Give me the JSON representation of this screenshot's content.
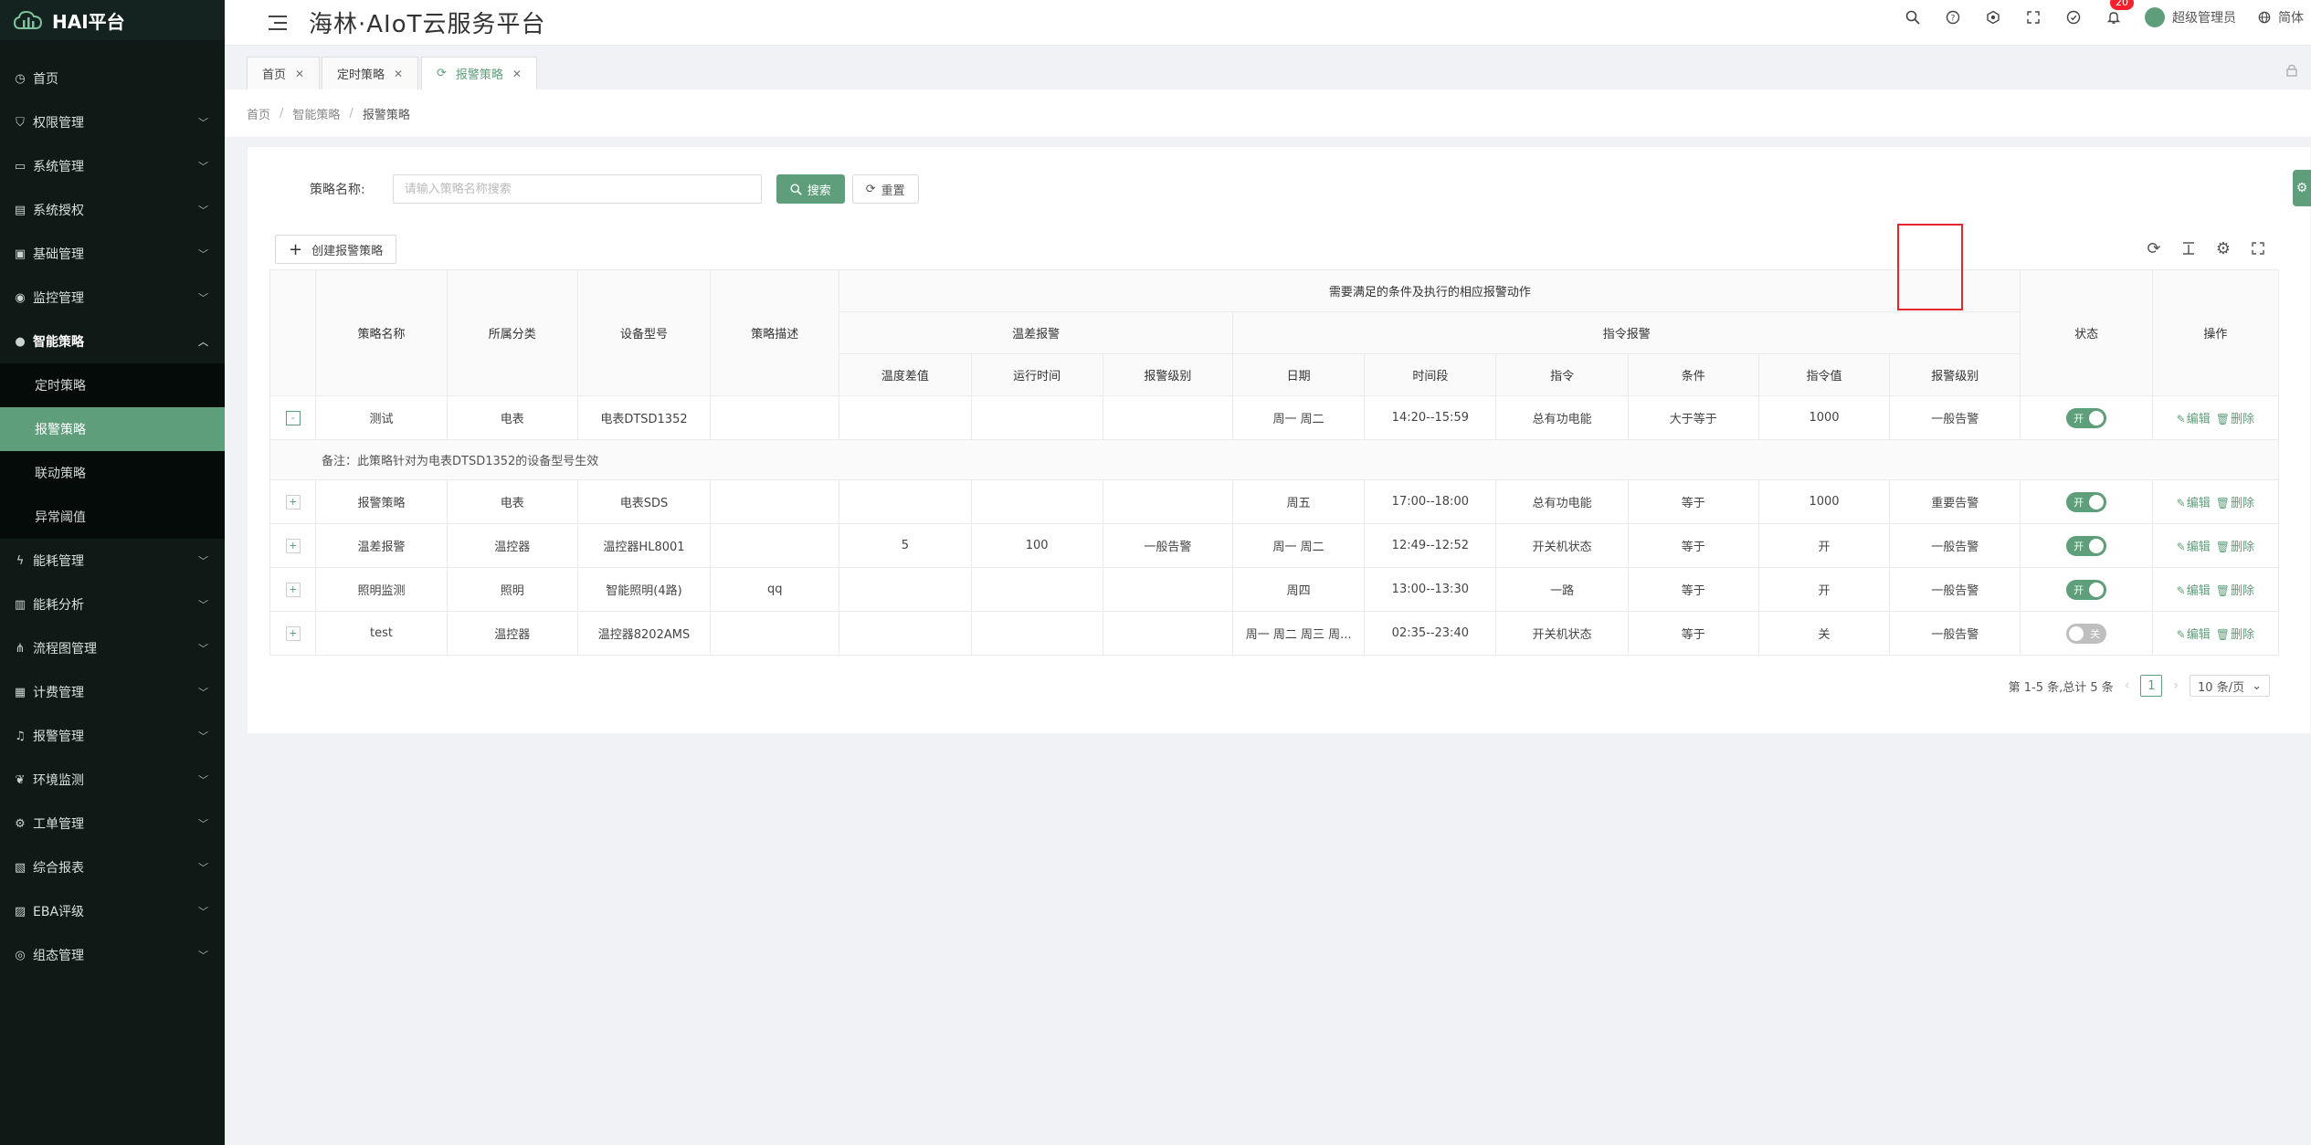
{
  "app": {
    "logo_text": "HAI平台",
    "platform_title": "海林·AIoT云服务平台"
  },
  "sidebar": {
    "items": [
      {
        "label": "首页",
        "icon": "clock-icon",
        "has_children": false
      },
      {
        "label": "权限管理",
        "icon": "shield-icon",
        "has_children": true
      },
      {
        "label": "系统管理",
        "icon": "monitor-icon",
        "has_children": true
      },
      {
        "label": "系统授权",
        "icon": "license-icon",
        "has_children": true
      },
      {
        "label": "基础管理",
        "icon": "box-icon",
        "has_children": true
      },
      {
        "label": "监控管理",
        "icon": "camera-icon",
        "has_children": true
      },
      {
        "label": "智能策略",
        "icon": "bulb-icon",
        "has_children": true,
        "open": true,
        "children": [
          {
            "label": "定时策略",
            "active": false
          },
          {
            "label": "报警策略",
            "active": true
          },
          {
            "label": "联动策略",
            "active": false
          },
          {
            "label": "异常阈值",
            "active": false
          }
        ]
      },
      {
        "label": "能耗管理",
        "icon": "bolt-icon",
        "has_children": true
      },
      {
        "label": "能耗分析",
        "icon": "chart-icon",
        "has_children": true
      },
      {
        "label": "流程图管理",
        "icon": "flow-icon",
        "has_children": true
      },
      {
        "label": "计费管理",
        "icon": "calendar-icon",
        "has_children": true
      },
      {
        "label": "报警管理",
        "icon": "alarm-icon",
        "has_children": true
      },
      {
        "label": "环境监测",
        "icon": "leaf-icon",
        "has_children": true
      },
      {
        "label": "工单管理",
        "icon": "gear-icon",
        "has_children": true
      },
      {
        "label": "综合报表",
        "icon": "report-icon",
        "has_children": true
      },
      {
        "label": "EBA评级",
        "icon": "grade-icon",
        "has_children": true
      },
      {
        "label": "组态管理",
        "icon": "target-icon",
        "has_children": true
      }
    ]
  },
  "header": {
    "notification_count": "20",
    "user_name": "超级管理员",
    "language": "简体"
  },
  "tabs": [
    {
      "label": "首页",
      "active": false
    },
    {
      "label": "定时策略",
      "active": false
    },
    {
      "label": "报警策略",
      "active": true
    }
  ],
  "breadcrumb": {
    "items": [
      "首页",
      "智能策略",
      "报警策略"
    ]
  },
  "search": {
    "label": "策略名称:",
    "placeholder": "请输入策略名称搜索",
    "value": "",
    "search_button": "搜索",
    "reset_button": "重置"
  },
  "toolbar": {
    "create_button": "创建报警策略"
  },
  "table": {
    "headers": {
      "name": "策略名称",
      "category": "所属分类",
      "device_model": "设备型号",
      "description": "策略描述",
      "group_conditions": "需要满足的条件及执行的相应报警动作",
      "group_temp": "温差报警",
      "group_cmd": "指令报警",
      "temp_diff": "温度差值",
      "run_time": "运行时间",
      "temp_level": "报警级别",
      "date": "日期",
      "time_range": "时间段",
      "command": "指令",
      "condition": "条件",
      "command_value": "指令值",
      "cmd_level": "报警级别",
      "status": "状态",
      "actions": "操作"
    },
    "rows": [
      {
        "name": "测试",
        "category": "电表",
        "device_model": "电表DTSD1352",
        "description": "",
        "temp_diff": "",
        "run_time": "",
        "temp_level": "",
        "date": "周一 周二",
        "time_range": "14:20--15:59",
        "command": "总有功电能",
        "condition": "大于等于",
        "command_value": "1000",
        "cmd_level": "一般告警",
        "status_label": "开",
        "enabled": true,
        "expanded": true,
        "expand_symbol": "-",
        "note": "备注：此策略针对为电表DTSD1352的设备型号生效"
      },
      {
        "name": "报警策略",
        "category": "电表",
        "device_model": "电表SDS",
        "description": "",
        "temp_diff": "",
        "run_time": "",
        "temp_level": "",
        "date": "周五",
        "time_range": "17:00--18:00",
        "command": "总有功电能",
        "condition": "等于",
        "command_value": "1000",
        "cmd_level": "重要告警",
        "status_label": "开",
        "enabled": true,
        "expanded": false,
        "expand_symbol": "+"
      },
      {
        "name": "温差报警",
        "category": "温控器",
        "device_model": "温控器HL8001",
        "description": "",
        "temp_diff": "5",
        "run_time": "100",
        "temp_level": "一般告警",
        "date": "周一 周二",
        "time_range": "12:49--12:52",
        "command": "开关机状态",
        "condition": "等于",
        "command_value": "开",
        "cmd_level": "一般告警",
        "status_label": "开",
        "enabled": true,
        "expanded": false,
        "expand_symbol": "+"
      },
      {
        "name": "照明监测",
        "category": "照明",
        "device_model": "智能照明(4路)",
        "description": "qq",
        "temp_diff": "",
        "run_time": "",
        "temp_level": "",
        "date": "周四",
        "time_range": "13:00--13:30",
        "command": "一路",
        "condition": "等于",
        "command_value": "开",
        "cmd_level": "一般告警",
        "status_label": "开",
        "enabled": true,
        "expanded": false,
        "expand_symbol": "+"
      },
      {
        "name": "test",
        "category": "温控器",
        "device_model": "温控器8202AMS",
        "description": "",
        "temp_diff": "",
        "run_time": "",
        "temp_level": "",
        "date": "周一 周二 周三 周...",
        "time_range": "02:35--23:40",
        "command": "开关机状态",
        "condition": "等于",
        "command_value": "关",
        "cmd_level": "一般告警",
        "status_label": "关",
        "enabled": false,
        "expanded": false,
        "expand_symbol": "+"
      }
    ],
    "edit_label": "编辑",
    "delete_label": "删除"
  },
  "pagination": {
    "summary": "第 1-5 条,总计 5 条",
    "current_page": "1",
    "page_size": "10 条/页"
  },
  "colors": {
    "accent": "#5e9e7a",
    "sidebar_bg": "#0f1a17",
    "highlight": "#e8262e",
    "badge": "#f5222d"
  }
}
